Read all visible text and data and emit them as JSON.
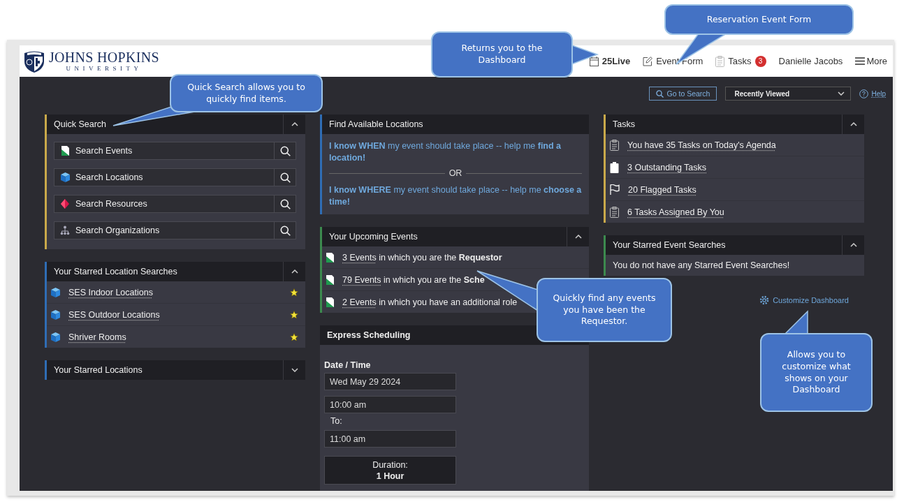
{
  "header": {
    "logo": {
      "name": "JOHNS HOPKINS",
      "sub": "UNIVERSITY"
    },
    "nav": [
      {
        "kind": "home",
        "label": "25Live"
      },
      {
        "kind": "form",
        "label": "Event Form"
      },
      {
        "kind": "tasks",
        "label": "Tasks",
        "badge": "3"
      },
      {
        "kind": "user",
        "label": "Danielle Jacobs"
      },
      {
        "kind": "menu",
        "label": "More"
      }
    ]
  },
  "toolbar": {
    "search_button": "Go to Search",
    "dropdown": "Recently Viewed",
    "help": "Help"
  },
  "quick_search": {
    "title": "Quick Search",
    "expanded": true,
    "items": [
      {
        "kind": "events",
        "label": "Search Events"
      },
      {
        "kind": "locations",
        "label": "Search Locations"
      },
      {
        "kind": "resources",
        "label": "Search Resources"
      },
      {
        "kind": "organizations",
        "label": "Search Organizations"
      }
    ]
  },
  "starred_location_searches": {
    "title": "Your Starred Location Searches",
    "expanded": true,
    "items": [
      {
        "label": "SES Indoor Locations",
        "starred": true
      },
      {
        "label": "SES Outdoor Locations",
        "starred": true
      },
      {
        "label": "Shriver Rooms",
        "starred": true
      }
    ]
  },
  "starred_locations": {
    "title": "Your Starred Locations",
    "expanded": false
  },
  "find_locations": {
    "title": "Find Available Locations",
    "options": [
      "**I know WHEN** my event should take place -- help me **find a location!**",
      "**I know WHERE** my event should take place -- help me **choose a time!**"
    ],
    "separator": "OR"
  },
  "upcoming_events": {
    "title": "Your Upcoming Events",
    "expanded": true,
    "items": [
      {
        "link": "3 Events",
        "text": "in which you are the **Requestor**"
      },
      {
        "link": "79 Events",
        "text": "in which you are the **Sche**"
      },
      {
        "link": "2 Events",
        "text": "in which you have an additional role"
      }
    ]
  },
  "express_scheduling": {
    "title": "Express Scheduling",
    "date_label": "Date / Time",
    "date": "Wed May 29 2024",
    "start": "10:00 am",
    "to_label": "To:",
    "end": "11:00 am",
    "duration_label": "Duration:",
    "duration": "1 Hour"
  },
  "tasks": {
    "title": "Tasks",
    "expanded": true,
    "items": [
      {
        "kind": "agenda",
        "label": "You have 35 Tasks on Today's Agenda"
      },
      {
        "kind": "outstanding",
        "label": "3 Outstanding Tasks"
      },
      {
        "kind": "flagged",
        "label": "20 Flagged Tasks"
      },
      {
        "kind": "assigned",
        "label": "6 Tasks Assigned By You"
      }
    ]
  },
  "starred_event_searches": {
    "title": "Your Starred Event Searches",
    "expanded": true,
    "message": "You do not have any Starred Event Searches!"
  },
  "customize": "Customize Dashboard",
  "callouts": [
    "Quick Search allows you to quickly find items.",
    "Returns you to the Dashboard",
    "Reservation Event Form",
    "Quickly find any events you have been the Requestor.",
    "Allows you to customize what shows on your Dashboard"
  ]
}
